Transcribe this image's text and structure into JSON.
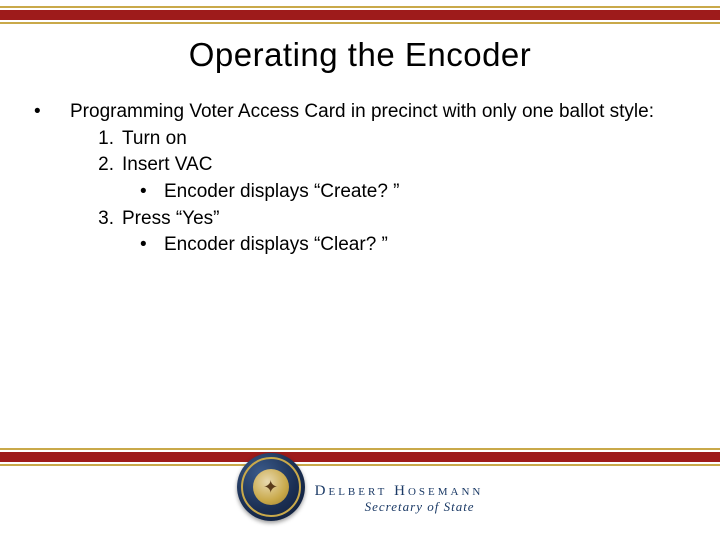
{
  "title": "Operating the Encoder",
  "intro": "Programming Voter Access Card in precinct with only one ballot style:",
  "steps": [
    {
      "num": "1.",
      "text": "Turn on",
      "sub": []
    },
    {
      "num": "2.",
      "text": "Insert VAC",
      "sub": [
        "Encoder displays “Create? ”"
      ]
    },
    {
      "num": "3.",
      "text": "Press “Yes”",
      "sub": [
        "Encoder displays “Clear? ”"
      ]
    }
  ],
  "footer": {
    "name": "Delbert Hosemann",
    "subtitle": "Secretary of State"
  },
  "colors": {
    "red": "#9e1b1b",
    "gold": "#c9a94a",
    "blue": "#1b3a66"
  }
}
